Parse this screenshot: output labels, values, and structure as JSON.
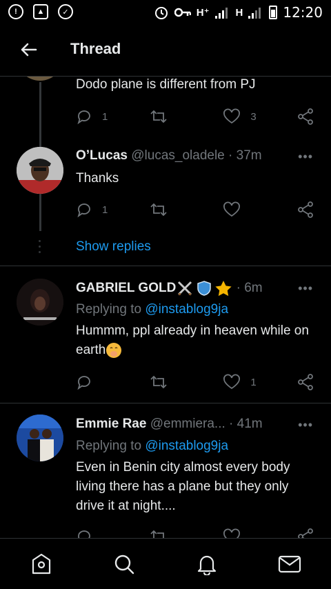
{
  "status_bar": {
    "network_left": "H⁺",
    "network_right": "H",
    "time": "12:20"
  },
  "header": {
    "title": "Thread"
  },
  "tweets": [
    {
      "text": "Dodo plane is different from PJ",
      "replies": "1",
      "retweets": "",
      "likes": "3"
    },
    {
      "name": "O’Lucas",
      "handle": "@lucas_oladele",
      "time": "· 37m",
      "text": "Thanks",
      "replies": "1",
      "retweets": "",
      "likes": "",
      "show_replies": "Show replies"
    },
    {
      "name": "GABRIEL GOLD",
      "time": "· 6m",
      "reply_prefix": "Replying to ",
      "reply_to": "@instablog9ja",
      "text": "Hummm, ppl already in heaven while on earth",
      "replies": "",
      "retweets": "",
      "likes": "1"
    },
    {
      "name": "Emmie Rae",
      "handle": "@emmiera...",
      "time": "· 41m",
      "reply_prefix": "Replying to ",
      "reply_to": "@instablog9ja",
      "text": "Even in Benin city almost every body living there has a plane but they only drive it at night...."
    }
  ],
  "icons": {
    "back": "arrow-left-icon",
    "more": "more-dots-icon",
    "reply": "reply-icon",
    "retweet": "retweet-icon",
    "like": "heart-icon",
    "share": "share-icon",
    "nav": [
      "home-icon",
      "search-icon",
      "bell-icon",
      "mail-icon"
    ]
  },
  "colors": {
    "background": "#000000",
    "text": "#e7e9ea",
    "muted": "#71767b",
    "link": "#1d9bf0",
    "divider": "#2f3336"
  }
}
